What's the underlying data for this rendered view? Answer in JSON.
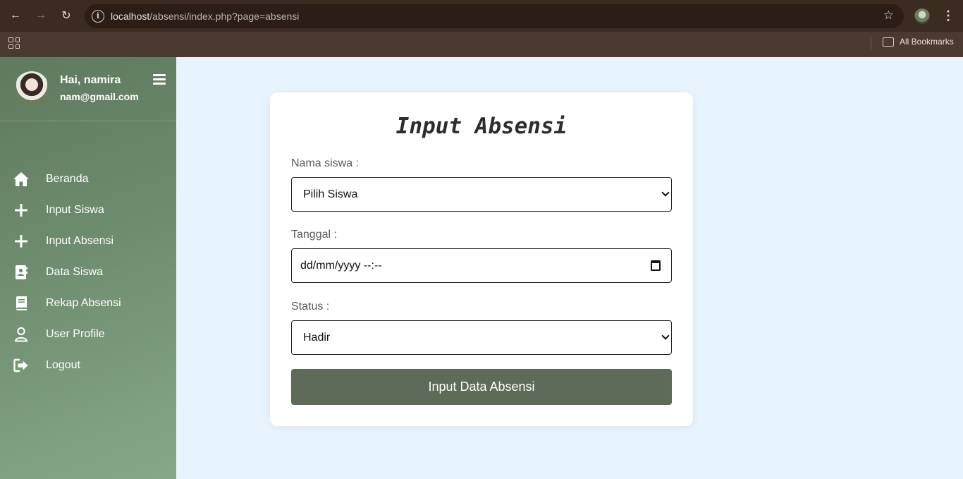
{
  "browser": {
    "url_host": "localhost",
    "url_path": "/absensi/index.php?page=absensi",
    "bookmarks_label": "All Bookmarks"
  },
  "sidebar": {
    "greeting": "Hai, namira",
    "email": "nam@gmail.com",
    "items": [
      {
        "label": "Beranda",
        "icon": "home-icon"
      },
      {
        "label": "Input Siswa",
        "icon": "plus-icon"
      },
      {
        "label": "Input Absensi",
        "icon": "plus-icon"
      },
      {
        "label": "Data Siswa",
        "icon": "address-book-icon"
      },
      {
        "label": "Rekap Absensi",
        "icon": "book-icon"
      },
      {
        "label": "User Profile",
        "icon": "user-icon"
      },
      {
        "label": "Logout",
        "icon": "logout-icon"
      }
    ]
  },
  "form": {
    "title": "Input Absensi",
    "nama_label": "Nama siswa :",
    "nama_value": "Pilih Siswa",
    "tanggal_label": "Tanggal :",
    "tanggal_value": "dd/mm/yyyy --:--",
    "status_label": "Status :",
    "status_value": "Hadir",
    "submit_label": "Input Data Absensi"
  },
  "colors": {
    "sidebar_start": "#5f7a5f",
    "sidebar_end": "#88a88a",
    "page_bg": "#e8f4fd",
    "submit_bg": "#5d6b58"
  }
}
